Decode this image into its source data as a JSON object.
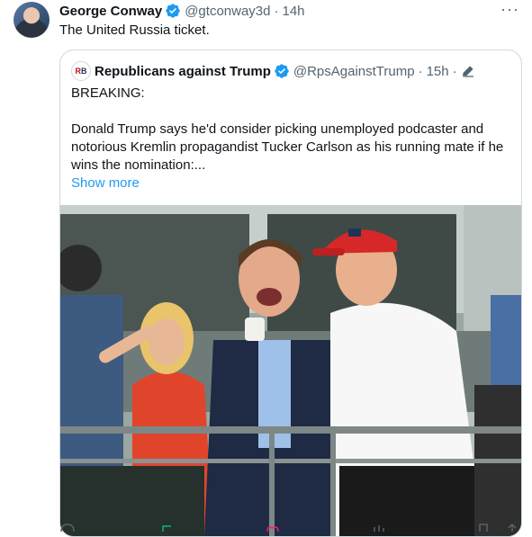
{
  "tweet": {
    "author_name": "George Conway",
    "author_handle": "@gtconway3d",
    "separator": "·",
    "time": "14h",
    "more": "···",
    "text": "The United Russia ticket.",
    "icons": {
      "verified": "verified-badge-icon",
      "more": "more-icon"
    }
  },
  "quote": {
    "author_name": "Republicans against Trump",
    "author_handle": "@RpsAgainstTrump",
    "separator": "·",
    "time": "15h",
    "separator2": "·",
    "avatar_letters": [
      "R",
      "B"
    ],
    "line1": "BREAKING:",
    "line2": "Donald Trump says he'd consider picking unemployed podcaster and notorious Kremlin propagandist Tucker Carlson as his running mate if he wins the nomination:...",
    "show_more": "Show more",
    "image_description_icon": "photo",
    "icons": {
      "verified": "verified-badge-icon",
      "edit": "edit-pencil-icon"
    }
  },
  "colors": {
    "link": "#1d9bf0",
    "text": "#0f1419",
    "muted": "#536471",
    "border": "#cfd9de",
    "hat_red": "#d62828"
  }
}
